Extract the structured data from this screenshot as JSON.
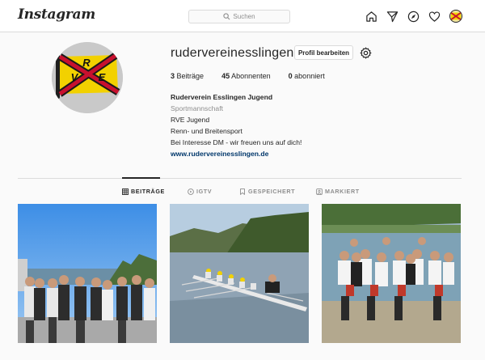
{
  "nav": {
    "logo": "Instagram",
    "search_placeholder": "Suchen",
    "icons": [
      "home-icon",
      "direct-icon",
      "explore-icon",
      "activity-heart-icon",
      "profile-avatar"
    ]
  },
  "profile": {
    "username": "rudervereinesslingen",
    "edit_label": "Profil bearbeiten",
    "stats": {
      "posts_count": "3",
      "posts_label": "Beiträge",
      "followers_count": "45",
      "followers_label": "Abonnenten",
      "following_count": "0",
      "following_label": "abonniert"
    },
    "bio": {
      "name": "Ruderverein Esslingen Jugend",
      "category": "Sportmannschaft",
      "lines": [
        "RVE Jugend",
        "Renn- und Breitensport",
        "Bei Interesse DM - wir freuen uns auf dich!"
      ],
      "link": "www.rudervereinesslingen.de"
    },
    "avatar_letters": [
      "R",
      "V",
      "E"
    ]
  },
  "tabs": [
    {
      "label": "BEITRÄGE",
      "icon": "grid-icon",
      "active": true
    },
    {
      "label": "IGTV",
      "icon": "igtv-icon",
      "active": false
    },
    {
      "label": "GESPEICHERT",
      "icon": "bookmark-icon",
      "active": false
    },
    {
      "label": "MARKIERT",
      "icon": "tagged-icon",
      "active": false
    }
  ],
  "posts": [
    "group-photo-lakeside",
    "rowing-boat-on-river",
    "team-on-dock"
  ],
  "colors": {
    "background": "#fafafa",
    "border": "#dbdbdb",
    "text": "#262626",
    "muted": "#8e8e8e",
    "link": "#00376b",
    "flag_yellow": "#f2d100",
    "flag_red": "#c8102e"
  }
}
